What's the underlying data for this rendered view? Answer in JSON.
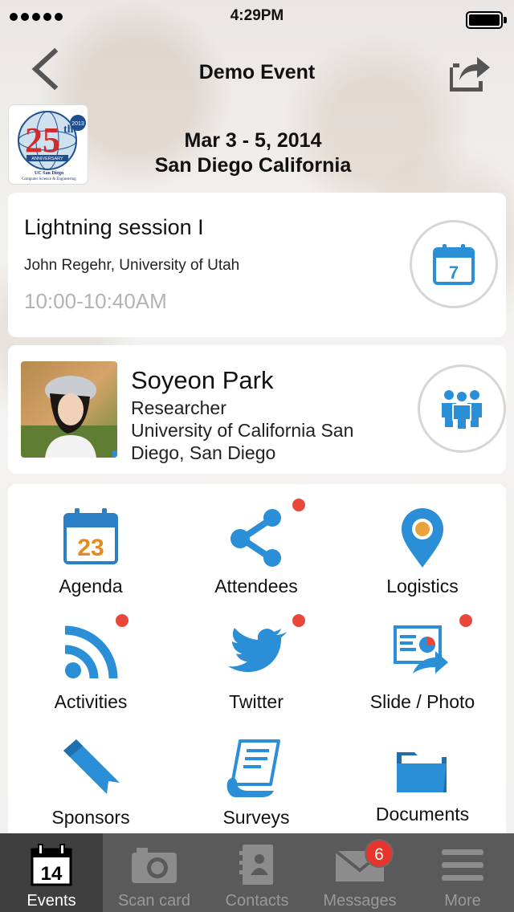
{
  "status_bar": {
    "time": "4:29PM"
  },
  "nav": {
    "title": "Demo Event"
  },
  "event": {
    "dates": "Mar 3 - 5, 2014",
    "location": "San Diego California",
    "logo_text": {
      "year": "2013",
      "number": "25",
      "suffix": "th",
      "anniversary": "ANNIVERSARY",
      "school": "UC San Diego",
      "dept": "Computer Science & Engineering"
    }
  },
  "session": {
    "title": "Lightning session I",
    "speaker": "John Regehr, University of Utah",
    "time": "10:00-10:40AM",
    "calendar_day": "7",
    "calendar_icon": "calendar-icon"
  },
  "person": {
    "name": "Soyeon Park",
    "role": "Researcher",
    "organization": "University of California San Diego, San Diego",
    "people_icon": "people-icon"
  },
  "menu": [
    {
      "label": "Agenda",
      "icon": "calendar-icon",
      "calendar_day": "23",
      "badge": false
    },
    {
      "label": "Attendees",
      "icon": "share-nodes-icon",
      "badge": true
    },
    {
      "label": "Logistics",
      "icon": "map-pin-icon",
      "badge": false
    },
    {
      "label": "Activities",
      "icon": "rss-icon",
      "badge": true
    },
    {
      "label": "Twitter",
      "icon": "twitter-bird-icon",
      "badge": true
    },
    {
      "label": "Slide / Photo",
      "icon": "slide-chart-icon",
      "badge": true
    },
    {
      "label": "Sponsors",
      "icon": "ribbon-icon",
      "badge": false
    },
    {
      "label": "Surveys",
      "icon": "document-scroll-icon",
      "badge": false
    },
    {
      "label": "Documents",
      "icon": "folder-icon",
      "badge": false
    }
  ],
  "tabbar": [
    {
      "label": "Events",
      "icon": "calendar-icon",
      "calendar_day": "14",
      "active": true
    },
    {
      "label": "Scan card",
      "icon": "camera-icon",
      "active": false
    },
    {
      "label": "Contacts",
      "icon": "contacts-book-icon",
      "active": false
    },
    {
      "label": "Messages",
      "icon": "envelope-icon",
      "badge": "6",
      "active": false
    },
    {
      "label": "More",
      "icon": "menu-icon",
      "active": false
    }
  ],
  "colors": {
    "accent_blue": "#2a8fd6",
    "badge_red": "#e8473c",
    "tabbar_bg": "#5a5a5a",
    "muted_text": "#b3b3b3"
  }
}
